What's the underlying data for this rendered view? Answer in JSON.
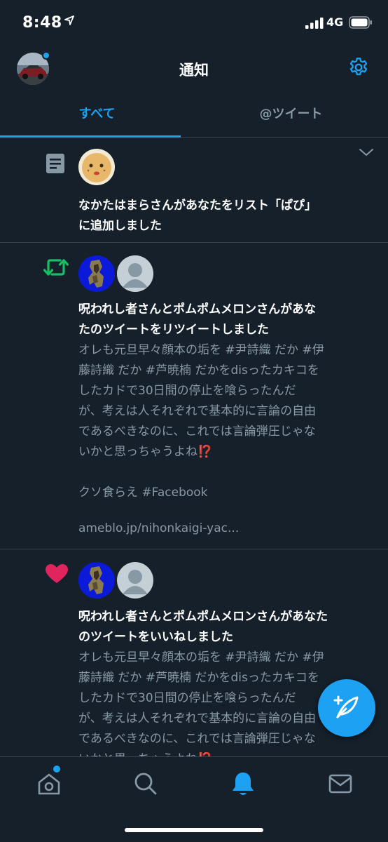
{
  "status_bar": {
    "time": "8:48",
    "network": "4G"
  },
  "header": {
    "title": "通知"
  },
  "tabs": [
    {
      "label": "すべて",
      "selected": true
    },
    {
      "label": "@ツイート",
      "selected": false
    }
  ],
  "notifications": [
    {
      "type": "list-add",
      "icon": "list-icon",
      "headline_line1": "なかたはまらさんがあなたをリスト「ぱぴ」",
      "headline_line2": "に追加しました"
    },
    {
      "type": "retweet",
      "icon": "retweet-icon",
      "headline_line1": "呪われし者さんとポムポムメロンさんがあな",
      "headline_line2": "たのツイートをリツイートしました",
      "body": "オレも元旦早々顔本の垢を #尹詩織 だか #伊\n藤詩織 だか #芦暁楠 だかをdisったカキコを\nしたカドで30日間の停止を喰らったんだ\nが、考えは人それぞれで基本的に言論の自由\nであるべきなのに、これでは言論弾圧じゃな\nいかと思っちゃうよね⁉️\n\nクソ食らえ #Facebook",
      "link": "ameblo.jp/nihonkaigi-yac..."
    },
    {
      "type": "like",
      "icon": "heart-icon",
      "headline_line1": "呪われし者さんとポムポムメロンさんがあなた",
      "headline_line2": "のツイートをいいねしました",
      "body": "オレも元旦早々顔本の垢を #尹詩織 だか #伊\n藤詩織 だか #芦暁楠 だかをdisったカキコを\nしたカドで30日間の停止を喰らったんだ\nが、考えは人それぞれで基本的に言論の自由\nであるべきなのに、これでは言論弾圧じゃな\nいかと思っちゃうよね⁉️"
    }
  ],
  "bottom_nav": [
    "home-icon",
    "search-icon",
    "bell-icon",
    "mail-icon"
  ],
  "colors": {
    "background": "#15202b",
    "accent": "#1da1f2",
    "divider": "#38444d",
    "muted": "#8899a6",
    "retweet": "#17bf63",
    "like": "#e0245e"
  }
}
